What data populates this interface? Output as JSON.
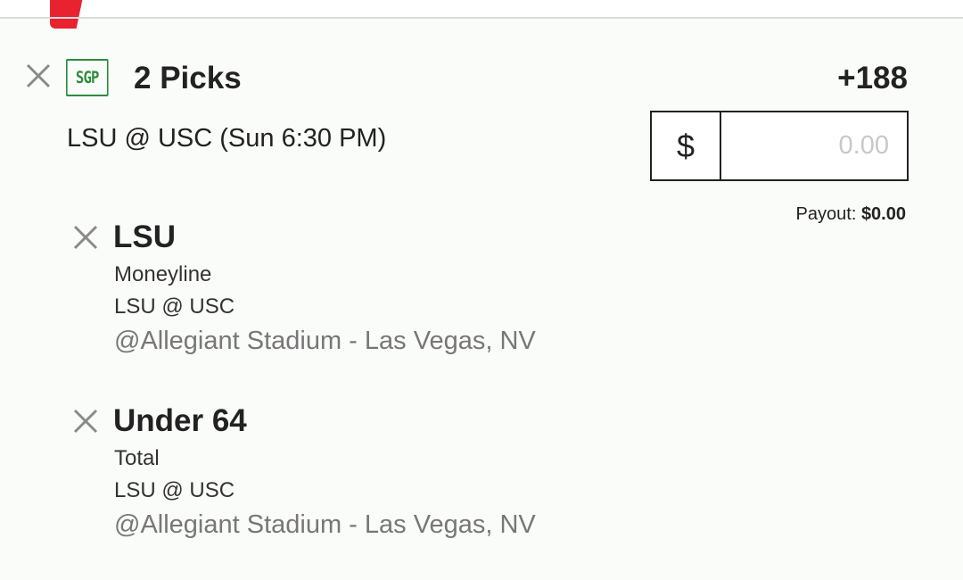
{
  "header": {
    "accent_color": "#e8232f"
  },
  "parlay": {
    "badge": "SGP",
    "badge_color": "#2e8b3e",
    "title": "2 Picks",
    "odds": "+188",
    "game": "LSU @ USC (Sun 6:30 PM)"
  },
  "wager": {
    "currency": "$",
    "placeholder": "0.00",
    "payout_label": "Payout:",
    "payout_value": "$0.00"
  },
  "legs": [
    {
      "selection": "LSU",
      "market": "Moneyline",
      "game": "LSU @ USC",
      "venue": "@Allegiant Stadium - Las Vegas, NV"
    },
    {
      "selection": "Under 64",
      "market": "Total",
      "game": "LSU @ USC",
      "venue": "@Allegiant Stadium - Las Vegas, NV"
    }
  ],
  "icons": {
    "remove": "close-icon"
  }
}
